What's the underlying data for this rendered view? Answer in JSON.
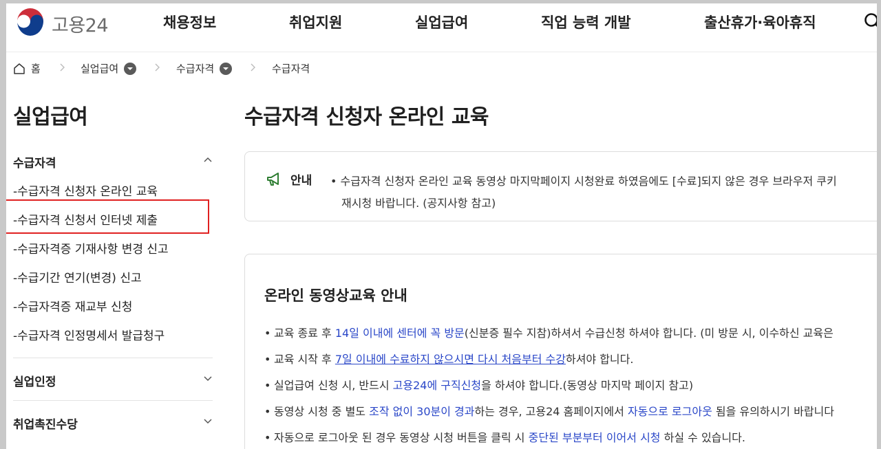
{
  "header": {
    "logo_text": "고용24",
    "nav": [
      "채용정보",
      "취업지원",
      "실업급여",
      "직업 능력 개발",
      "출산휴가·육아휴직"
    ]
  },
  "breadcrumb": {
    "home": "홈",
    "level1": "실업급여",
    "level2": "수급자격",
    "level3": "수급자격"
  },
  "sidebar": {
    "title": "실업급여",
    "group1": "수급자격",
    "items": [
      "-수급자격 신청자 온라인 교육",
      "-수급자격 신청서 인터넷 제출",
      "-수급자격증 기재사항 변경 신고",
      "-수급기간 연기(변경) 신고",
      "-수급자격증 재교부 신청",
      "-수급자격 인정명세서 발급청구"
    ],
    "group2": "실업인정",
    "group3": "취업촉진수당"
  },
  "content": {
    "title": "수급자격 신청자 온라인 교육",
    "notice_label": "안내",
    "notice_line1": "• 수급자격 신청자 온라인 교육 동영상 마지막페이지 시청완료 하였음에도 [수료]되지 않은 경우 브라우저 쿠키",
    "notice_line2": "재시청 바랍니다. (공지사항 참고)",
    "card_title": "온라인 동영상교육 안내",
    "b1": {
      "a": "교육 종료 후 ",
      "b": "14일 이내에 센터에 꼭 방문",
      "c": "(신분증 필수 지참)하셔서 수급신청 하셔야 합니다. (미 방문 시, 이수하신 교육은"
    },
    "b2": {
      "a": "교육 시작 후 ",
      "b": "7일 이내에 수료하지 않으시면 다시 처음부터 수강",
      "c": "하셔야 합니다."
    },
    "b3": {
      "a": "실업급여 신청 시, 반드시 ",
      "b": "고용24에 구직신청",
      "c": "을 하셔야 합니다.(동영상 마지막 페이지 참고)"
    },
    "b4": {
      "a": "동영상 시청 중 별도 ",
      "b": "조작 없이 30분이 경과",
      "c": "하는 경우, 고용24 홈페이지에서 ",
      "d": "자동으로 로그아웃",
      "e": " 됨을 유의하시기 바랍니다"
    },
    "b5": {
      "a": "자동으로 로그아웃 된 경우 동영상 시청 버튼을 클릭 시 ",
      "b": "중단된 부분부터 이어서 시청",
      "c": " 하실 수 있습니다."
    }
  },
  "colors": {
    "accent_blue": "#2a47c8",
    "highlight_red": "#e02020"
  }
}
